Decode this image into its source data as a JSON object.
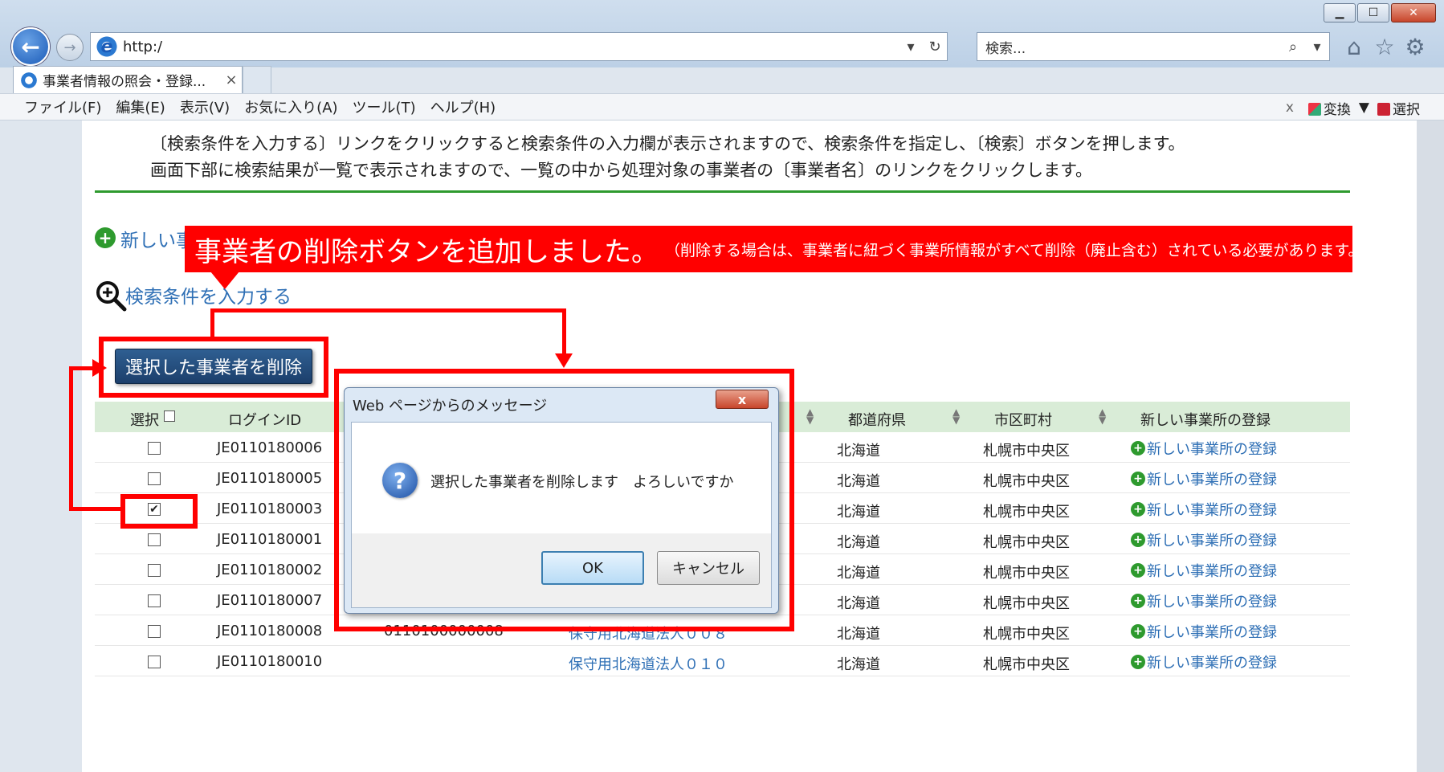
{
  "browser": {
    "address": "http:/",
    "search_placeholder": "検索...",
    "tab_title": "事業者情報の照会・登録...",
    "tab_close": "×",
    "menu": [
      "ファイル(F)",
      "編集(E)",
      "表示(V)",
      "お気に入り(A)",
      "ツール(T)",
      "ヘルプ(H)"
    ],
    "menu_right_close": "x",
    "menu_right_convert": "変換",
    "menu_right_select": "選択"
  },
  "page": {
    "desc_line1": "〔検索条件を入力する〕リンクをクリックすると検索条件の入力欄が表示されますので、検索条件を指定し、〔検索〕ボタンを押します。",
    "desc_line2": "画面下部に検索結果が一覧で表示されますので、一覧の中から処理対象の事業者の〔事業者名〕のリンクをクリックします。",
    "new_link": "新しい事",
    "search_toggle": "検索条件を入力する",
    "delete_button": "選択した事業者を削除"
  },
  "table": {
    "headers": {
      "select": "選択",
      "login_id": "ログインID",
      "prefecture": "都道府県",
      "city": "市区町村",
      "new_office": "新しい事業所の登録"
    },
    "rows": [
      {
        "checked": "",
        "login_id": "JE0110180006",
        "number": "",
        "name": "",
        "prefecture": "北海道",
        "city": "札幌市中央区",
        "register": "新しい事業所の登録"
      },
      {
        "checked": "",
        "login_id": "JE0110180005",
        "number": "",
        "name": "",
        "prefecture": "北海道",
        "city": "札幌市中央区",
        "register": "新しい事業所の登録"
      },
      {
        "checked": "✔",
        "login_id": "JE0110180003",
        "number": "",
        "name": "",
        "prefecture": "北海道",
        "city": "札幌市中央区",
        "register": "新しい事業所の登録"
      },
      {
        "checked": "",
        "login_id": "JE0110180001",
        "number": "",
        "name": "",
        "prefecture": "北海道",
        "city": "札幌市中央区",
        "register": "新しい事業所の登録"
      },
      {
        "checked": "",
        "login_id": "JE0110180002",
        "number": "",
        "name": "",
        "prefecture": "北海道",
        "city": "札幌市中央区",
        "register": "新しい事業所の登録"
      },
      {
        "checked": "",
        "login_id": "JE0110180007",
        "number": "",
        "name": "",
        "prefecture": "北海道",
        "city": "札幌市中央区",
        "register": "新しい事業所の登録"
      },
      {
        "checked": "",
        "login_id": "JE0110180008",
        "number": "0110100000008",
        "name": "保守用北海道法人００８",
        "prefecture": "北海道",
        "city": "札幌市中央区",
        "register": "新しい事業所の登録"
      },
      {
        "checked": "",
        "login_id": "JE0110180010",
        "number": "",
        "name": "保守用北海道法人０１０",
        "prefecture": "北海道",
        "city": "札幌市中央区",
        "register": "新しい事業所の登録"
      }
    ]
  },
  "annotation": {
    "main": "事業者の削除ボタンを追加しました。",
    "sub": "（削除する場合は、事業者に紐づく事業所情報がすべて削除（廃止含む）されている必要があります。）"
  },
  "dialog": {
    "title": "Web ページからのメッセージ",
    "close": "x",
    "message": "選択した事業者を削除します　よろしいですか",
    "ok": "OK",
    "cancel": "キャンセル"
  },
  "colors": {
    "annotation_red": "#ff0000",
    "link_blue": "#2e6fb5",
    "header_green": "#d9ecd7",
    "divider_green": "#2e9a2e",
    "button_navy": "#1c3f6b"
  }
}
